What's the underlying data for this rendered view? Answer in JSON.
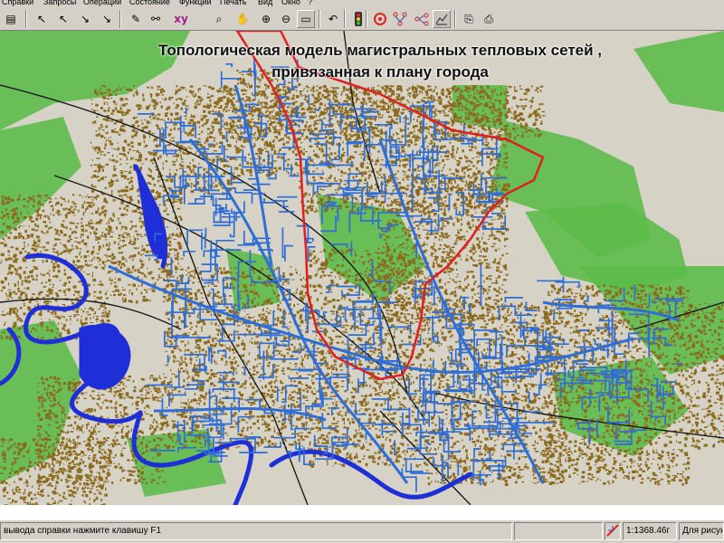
{
  "menu": {
    "items": [
      "Справки",
      "Запросы",
      "Операции",
      "Состояние",
      "Функции",
      "Печать",
      "Вид",
      "Окно",
      "?"
    ]
  },
  "toolbar": {
    "icons": [
      "save-icon",
      "pointer-icon",
      "select-arrow-icon",
      "select-arrow-x-icon",
      "select-arrow-plus-icon",
      "pencil-icon",
      "binoculars-icon",
      "xy-icon",
      "zoom-magnifier-icon",
      "hand-pan-icon",
      "zoom-in-icon",
      "zoom-out-icon",
      "zoom-extent-icon",
      "undo-icon",
      "traffic-light-icon",
      "target-icon",
      "network-nodes-icon",
      "network-graph-icon",
      "chart-icon",
      "copy-icon",
      "print-icon"
    ],
    "xy_label": "xy"
  },
  "map": {
    "title_line1": "Топологическая модель магистральных тепловых сетей ,",
    "title_line2": "привязанная к  плану города",
    "colors": {
      "background": "#d6d2c6",
      "green_zones": "#5dbb4a",
      "buildings": "#8b6a1e",
      "heat_network": "#2f6ed6",
      "water": "#1e2fd8",
      "district_boundary": "#e02020",
      "railways": "#1a1a1a"
    }
  },
  "status": {
    "help_text": "вывода справки нажмите клавишу F1",
    "scale": "1:1368.46г",
    "mode": "Для рисунк"
  }
}
